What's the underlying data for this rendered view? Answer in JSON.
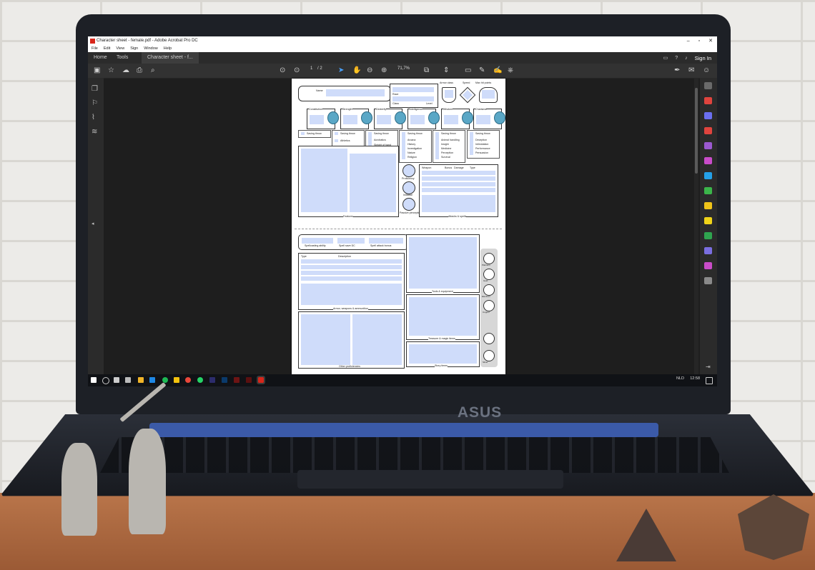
{
  "window": {
    "title": "Character sheet - female.pdf - Adobe Acrobat Pro DC",
    "controls": [
      "–",
      "▫",
      "✕"
    ]
  },
  "menu": [
    "File",
    "Edit",
    "View",
    "Sign",
    "Window",
    "Help"
  ],
  "tabs": {
    "home": "Home",
    "tools": "Tools",
    "document": "Character sheet - f...",
    "sign_in": "Sign In"
  },
  "toolbar": {
    "page_current": "1",
    "page_total": "/ 2",
    "zoom": "71,7%"
  },
  "brand": "ASUS",
  "sheet": {
    "name_label": "Name",
    "race_label": "Race",
    "class_label": "Class",
    "level_label": "Level",
    "armor_class_label": "Armor class",
    "speed_label": "Speed",
    "max_hp_label": "Max hit points",
    "abilities": [
      "Constitution",
      "Strength",
      "Dexterity",
      "Intelligence",
      "Wisdom",
      "Charisma"
    ],
    "saving_throw": "Saving throw",
    "skill_groups": [
      [
        "Athletics"
      ],
      [
        "Acrobatics",
        "Sleight of hand",
        "Stealth"
      ],
      [
        "Arcana",
        "History",
        "Investigation",
        "Nature",
        "Religion"
      ],
      [
        "Animal handling",
        "Insight",
        "Medicine",
        "Perception",
        "Survival"
      ],
      [
        "Deception",
        "Intimidation",
        "Performance",
        "Persuasion"
      ]
    ],
    "features_label": "Features",
    "proficiency_label": "Proficiency",
    "initiative_label": "Initiative",
    "passive_perception_label": "Passive perception",
    "attacks": {
      "weapon": "Weapon",
      "bonus": "Bonus",
      "damage": "Damage",
      "type": "Type",
      "footer": "Attacks & spells"
    },
    "spellcasting": [
      "Spellcasting ability",
      "Spell save DC",
      "Spell attack bonus"
    ],
    "armor_table": {
      "type": "Type",
      "description": "Description",
      "footer": "Armor, weapons & ammunition"
    },
    "tools_label": "Tools & equipment",
    "treasure_label": "Treasure & magic items",
    "other_prof_label": "Other proficiencies",
    "story_label": "Story items",
    "coins": [
      "Platinum",
      "Gold",
      "Electrum",
      "Copper",
      "Silver"
    ]
  },
  "taskbar": {
    "lang": "NLD",
    "time": "12:58"
  },
  "colors": {
    "field": "#cfdcfa",
    "accent_icon": "#5aa7c6",
    "taskbar": "#101216"
  }
}
